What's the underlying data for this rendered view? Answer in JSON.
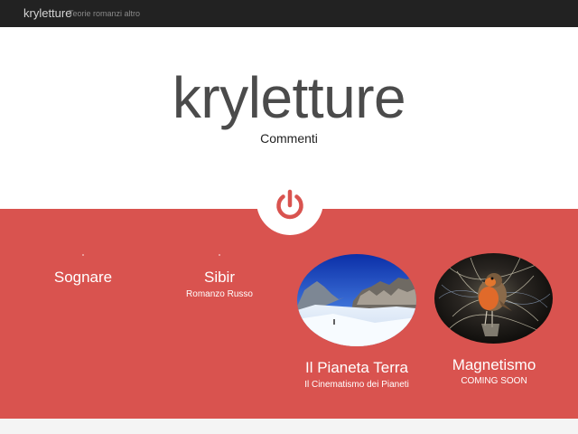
{
  "navbar": {
    "brand": "kryletture",
    "tagline": "Teorie romanzi altro"
  },
  "hero": {
    "title": "kryletture",
    "link": "Commenti"
  },
  "colors": {
    "navbar_bg": "#222222",
    "accent_band": "#d9534f",
    "title_text": "#4b4b4b"
  },
  "power_icon": "power-icon",
  "items": [
    {
      "title": "Sognare",
      "subtitle": ""
    },
    {
      "title": "Sibir",
      "subtitle": "Romanzo Russo"
    },
    {
      "title": "Il Pianeta Terra",
      "subtitle": "Il Cinematismo dei Pianeti"
    },
    {
      "title": "Magnetismo",
      "subtitle": "COMING SOON"
    }
  ]
}
